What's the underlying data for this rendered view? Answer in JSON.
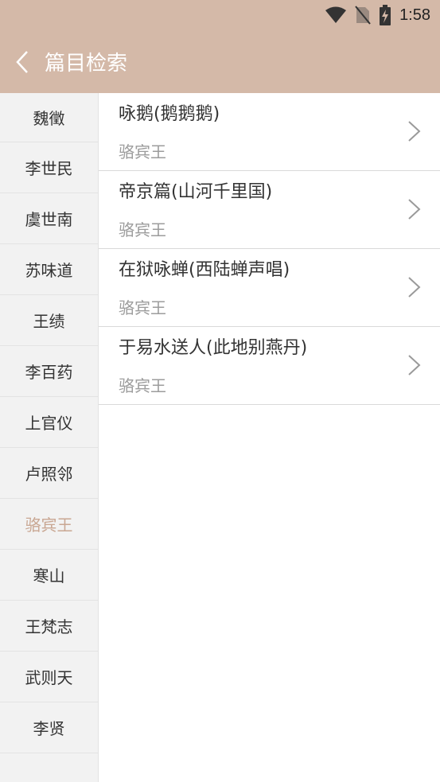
{
  "status_bar": {
    "time": "1:58",
    "icons": [
      "wifi-icon",
      "no-sim-icon",
      "battery-charging-icon"
    ]
  },
  "toolbar": {
    "back_icon": "chevron-left-icon",
    "title": "篇目检索"
  },
  "colors": {
    "header_bg": "#d4b9a8",
    "active_author": "#c9a793",
    "sidebar_bg": "#f2f2f2"
  },
  "sidebar": {
    "selected": "骆宾王",
    "items": [
      {
        "label": "魏徵"
      },
      {
        "label": "李世民"
      },
      {
        "label": "虞世南"
      },
      {
        "label": "苏味道"
      },
      {
        "label": "王绩"
      },
      {
        "label": "李百药"
      },
      {
        "label": "上官仪"
      },
      {
        "label": "卢照邻"
      },
      {
        "label": "骆宾王"
      },
      {
        "label": "寒山"
      },
      {
        "label": "王梵志"
      },
      {
        "label": "武则天"
      },
      {
        "label": "李贤"
      }
    ]
  },
  "poems": [
    {
      "title": "咏鹅(鹅鹅鹅)",
      "author": "骆宾王"
    },
    {
      "title": "帝京篇(山河千里国)",
      "author": "骆宾王"
    },
    {
      "title": "在狱咏蝉(西陆蝉声唱)",
      "author": "骆宾王"
    },
    {
      "title": "于易水送人(此地别燕丹)",
      "author": "骆宾王"
    }
  ]
}
